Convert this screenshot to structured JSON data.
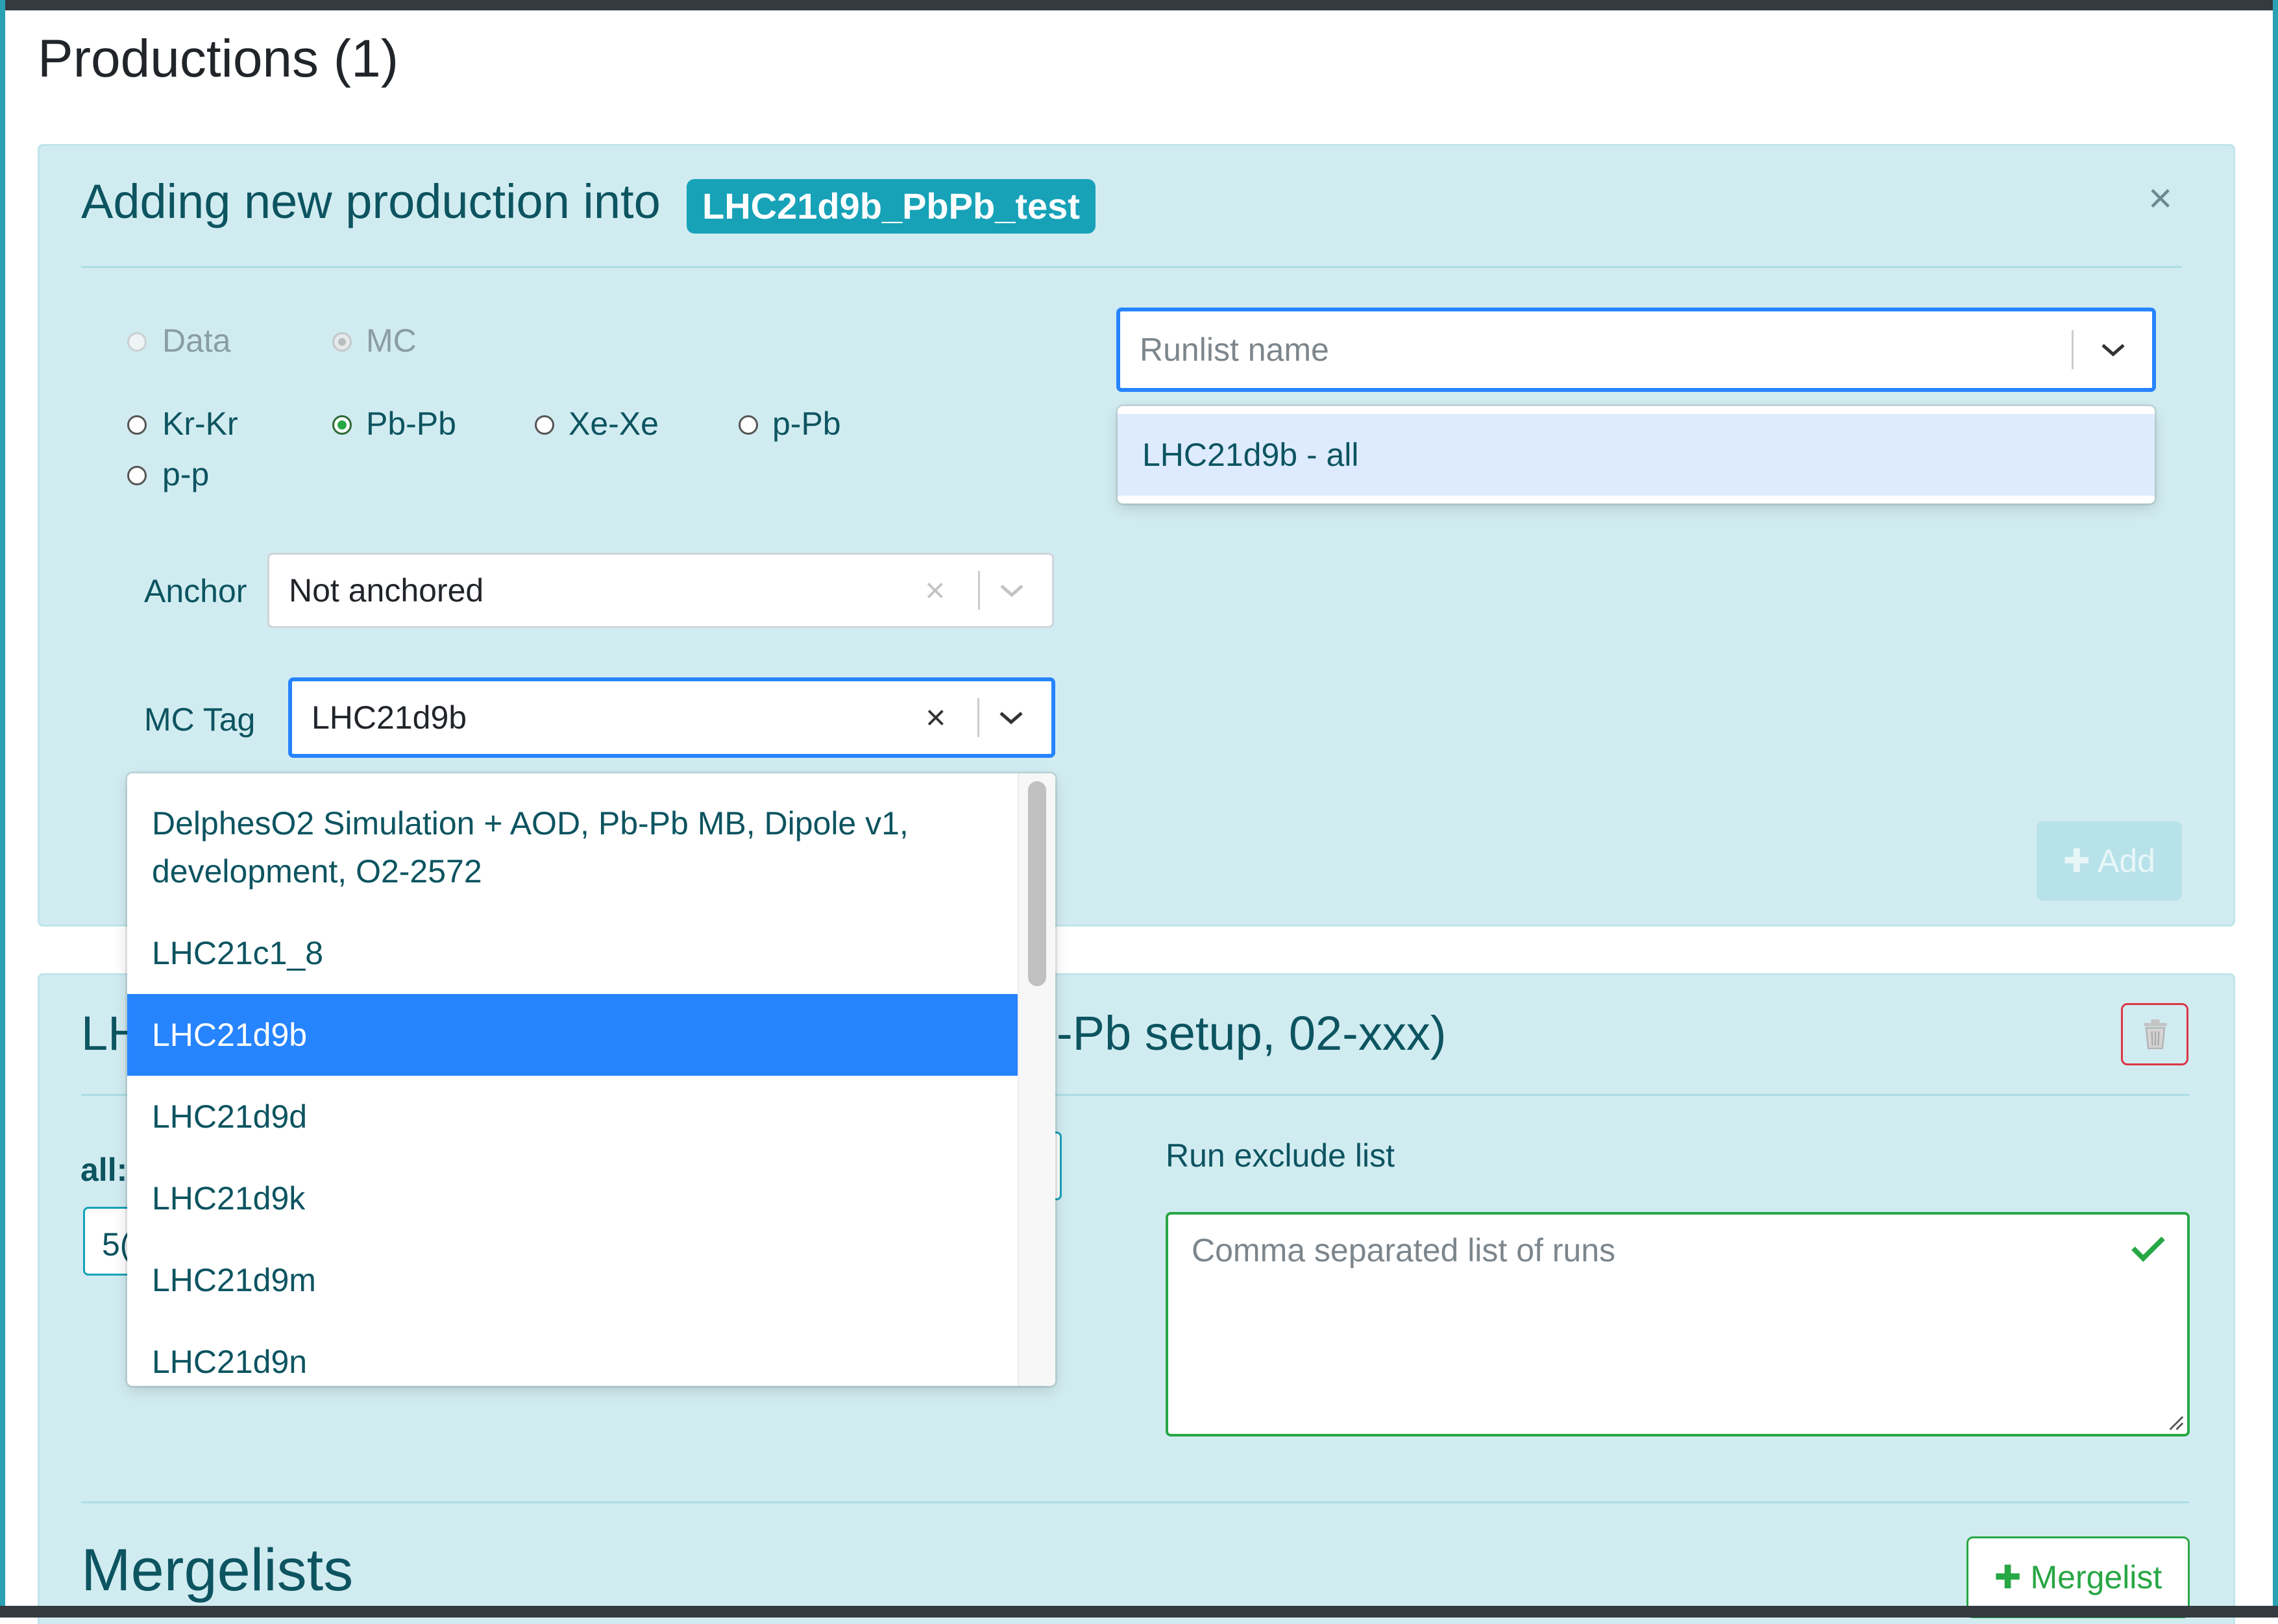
{
  "page": {
    "title": "Productions (1)"
  },
  "new_production": {
    "heading": "Adding new production into",
    "production_name": "LHC21d9b_PbPb_test",
    "close_symbol": "×",
    "type_options": [
      {
        "label": "Data",
        "selected": false
      },
      {
        "label": "MC",
        "selected": true
      }
    ],
    "system_options": [
      {
        "label": "Kr-Kr",
        "selected": false
      },
      {
        "label": "Pb-Pb",
        "selected": true
      },
      {
        "label": "Xe-Xe",
        "selected": false
      },
      {
        "label": "p-Pb",
        "selected": false
      },
      {
        "label": "p-p",
        "selected": false
      }
    ],
    "anchor": {
      "label": "Anchor",
      "value": "Not anchored"
    },
    "mc_tag": {
      "label": "MC Tag",
      "value": "LHC21d9b",
      "options": [
        {
          "label": "DelphesO2 Simulation + AOD, Pb-Pb MB, Dipole v1, development, O2-2572",
          "selected": false
        },
        {
          "label": "LHC21c1_8",
          "selected": false
        },
        {
          "label": "LHC21d9b",
          "selected": true
        },
        {
          "label": "LHC21d9d",
          "selected": false
        },
        {
          "label": "LHC21d9k",
          "selected": false
        },
        {
          "label": "LHC21d9m",
          "selected": false
        },
        {
          "label": "LHC21d9n",
          "selected": false
        }
      ]
    },
    "runlist": {
      "placeholder": "Runlist name",
      "options": [
        "LHC21d9b - all"
      ]
    },
    "add_button": "✚ Add"
  },
  "existing_production": {
    "heading_left": "LH",
    "heading_right": "-Pb setup, 02-xxx)",
    "label_partial": "all:",
    "input_partial": "5(",
    "exclude_label": "Run exclude list",
    "exclude_placeholder": "Comma separated list of runs",
    "mergelists_title": "Mergelists",
    "mergelist_button": "✚ Mergelist"
  },
  "colors": {
    "accent": "#17a2b8",
    "card_bg": "#d1ecf1",
    "card_text": "#0c5460",
    "focus": "#2684ff",
    "valid": "#28a745",
    "danger": "#dc3545"
  },
  "icons": [
    "close-icon",
    "chevron-down-icon",
    "clear-icon",
    "check-icon",
    "trash-icon",
    "plus-icon"
  ]
}
